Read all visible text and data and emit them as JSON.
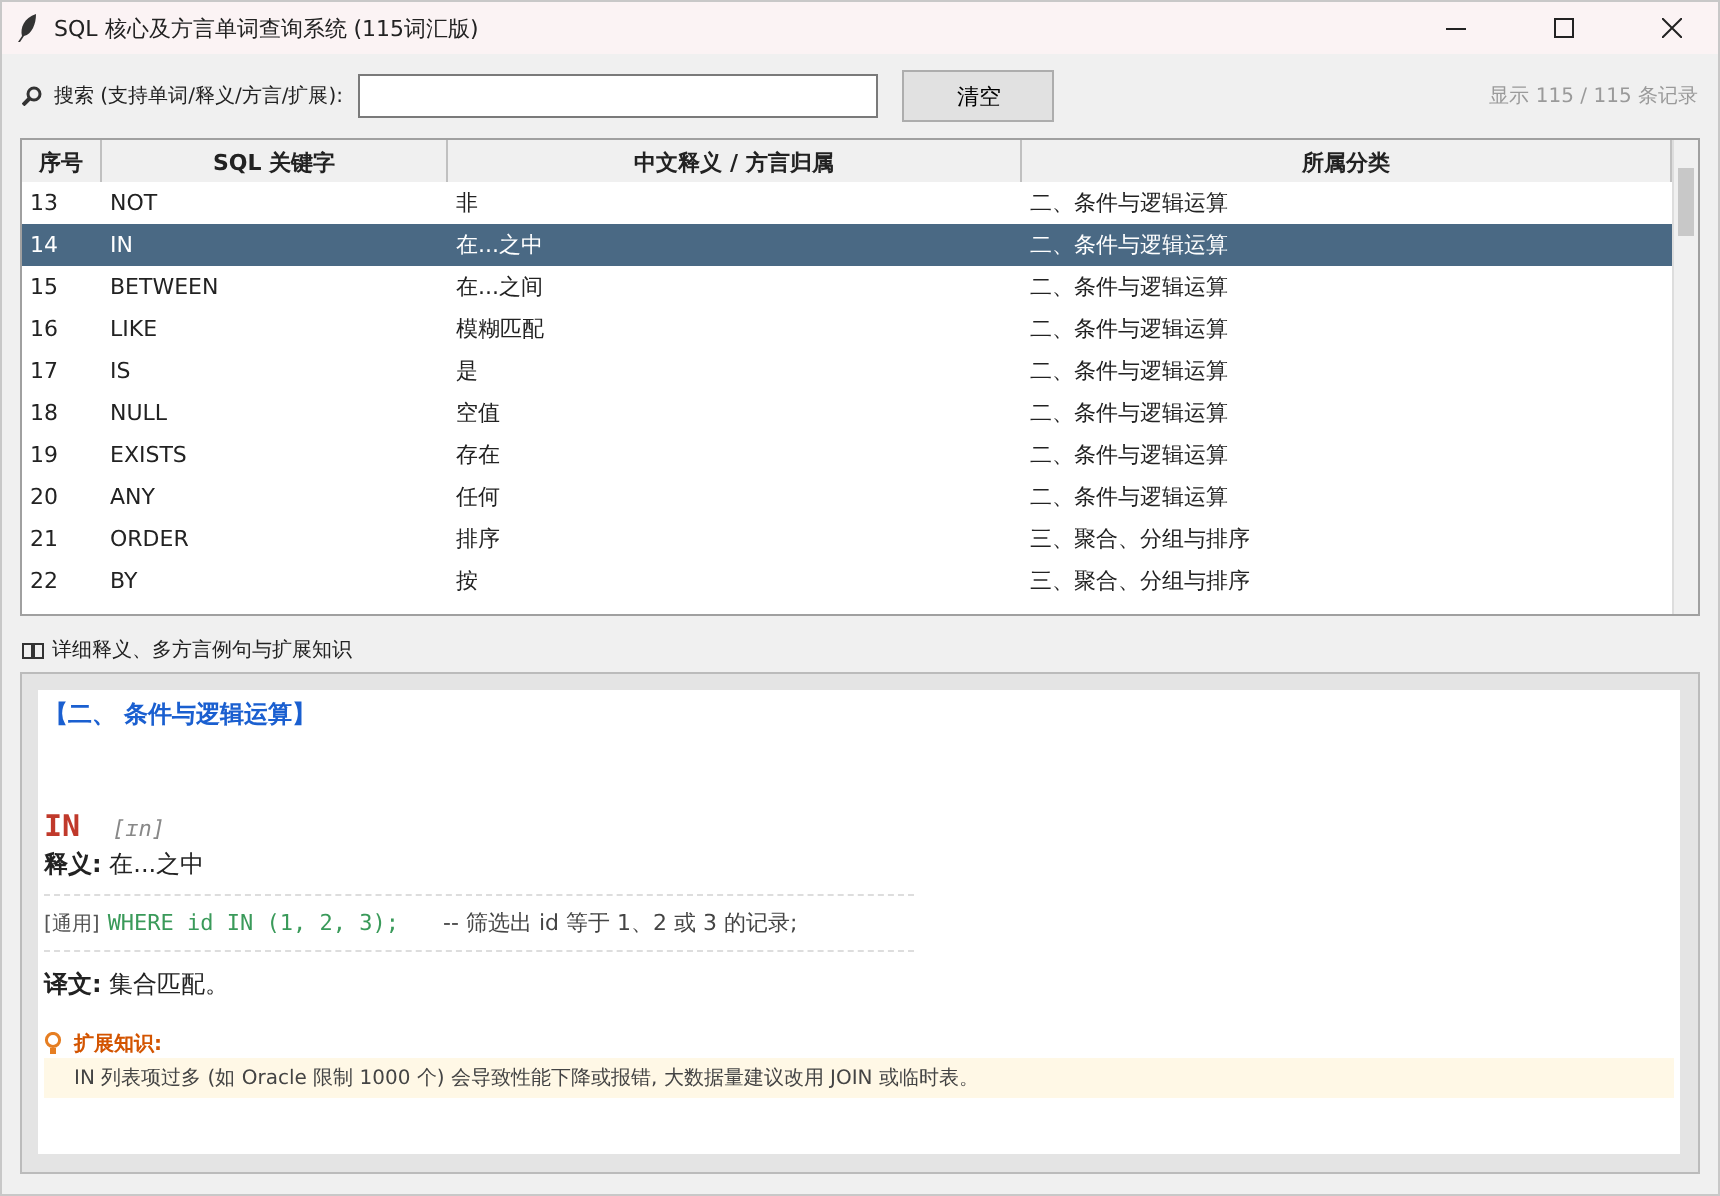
{
  "window": {
    "title": "SQL 核心及方言单词查询系统 (115词汇版)"
  },
  "search": {
    "label": "搜索 (支持单词/释义/方言/扩展):",
    "button": "清空",
    "count": "显示 115 / 115 条记录"
  },
  "table": {
    "columns": [
      "序号",
      "SQL 关键字",
      "中文释义 / 方言归属",
      "所属分类"
    ],
    "rows": [
      {
        "cells": [
          "13",
          "NOT",
          "非",
          "二、条件与逻辑运算"
        ],
        "selected": false
      },
      {
        "cells": [
          "14",
          "IN",
          "在...之中",
          "二、条件与逻辑运算"
        ],
        "selected": true
      },
      {
        "cells": [
          "15",
          "BETWEEN",
          "在...之间",
          "二、条件与逻辑运算"
        ],
        "selected": false
      },
      {
        "cells": [
          "16",
          "LIKE",
          "模糊匹配",
          "二、条件与逻辑运算"
        ],
        "selected": false
      },
      {
        "cells": [
          "17",
          "IS",
          "是",
          "二、条件与逻辑运算"
        ],
        "selected": false
      },
      {
        "cells": [
          "18",
          "NULL",
          "空值",
          "二、条件与逻辑运算"
        ],
        "selected": false
      },
      {
        "cells": [
          "19",
          "EXISTS",
          "存在",
          "二、条件与逻辑运算"
        ],
        "selected": false
      },
      {
        "cells": [
          "20",
          "ANY",
          "任何",
          "二、条件与逻辑运算"
        ],
        "selected": false
      },
      {
        "cells": [
          "21",
          "ORDER",
          "排序",
          "三、聚合、分组与排序"
        ],
        "selected": false
      },
      {
        "cells": [
          "22",
          "BY",
          "按",
          "三、聚合、分组与排序"
        ],
        "selected": false
      }
    ]
  },
  "detail": {
    "section_title": "详细释义、多方言例句与扩展知识",
    "category": "【二、 条件与逻辑运算】",
    "word": "IN",
    "phonetic": "[ɪn]",
    "meaning_label": "释义:",
    "meaning": "在...之中",
    "example": {
      "tag": "[通用]",
      "code": "WHERE id IN (1, 2, 3);",
      "comment": "-- 筛选出 id 等于 1、2 或 3 的记录;"
    },
    "translation_label": "译文:",
    "translation": "集合匹配。",
    "ext_title": "扩展知识:",
    "ext_text": "IN 列表项过多 (如 Oracle 限制 1000 个) 会导致性能下降或报错, 大数据量建议改用 JOIN 或临时表。"
  }
}
